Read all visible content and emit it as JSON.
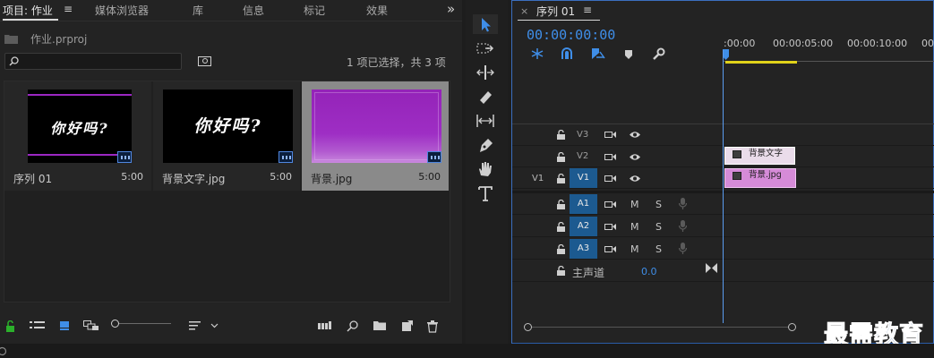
{
  "project": {
    "tabs": [
      {
        "label": "项目: 作业"
      },
      {
        "label": "媒体浏览器"
      },
      {
        "label": "库"
      },
      {
        "label": "信息"
      },
      {
        "label": "标记"
      },
      {
        "label": "效果"
      }
    ],
    "menu_icon": "≡",
    "overflow_icon": "»",
    "file_name": "作业.prproj",
    "search_placeholder": "",
    "selection_status": "1 项已选择，共 3 项",
    "items": [
      {
        "name": "序列 01",
        "duration": "5:00",
        "thumb_text": "你好吗?"
      },
      {
        "name": "背景文字.jpg",
        "duration": "5:00",
        "thumb_text": "你好吗?"
      },
      {
        "name": "背景.jpg",
        "duration": "5:00",
        "thumb_text": ""
      }
    ]
  },
  "timeline": {
    "title": "序列 01",
    "close_icon": "×",
    "menu_icon": "≡",
    "timecode": "00:00:00:00",
    "ruler_labels": [
      ":00:00",
      "00:00:05:00",
      "00:00:10:00",
      "00"
    ],
    "video_tracks": [
      {
        "label": "V3",
        "source": ""
      },
      {
        "label": "V2",
        "source": ""
      },
      {
        "label": "V1",
        "source": "V1"
      }
    ],
    "audio_tracks": [
      {
        "label": "A1",
        "m": "M",
        "s": "S"
      },
      {
        "label": "A2",
        "m": "M",
        "s": "S"
      },
      {
        "label": "A3",
        "m": "M",
        "s": "S"
      }
    ],
    "master": {
      "label": "主声道",
      "value": "0.0"
    },
    "clips": [
      {
        "track": "V2",
        "name": "背景文字"
      },
      {
        "track": "V1",
        "name": "背景.jpg"
      }
    ]
  },
  "watermark": "最需教育",
  "colors": {
    "accent": "#3f8ee8",
    "clip": "#d68bd8",
    "purple": "#9b27c2",
    "work_area": "#e0d21a",
    "target_blue": "#1c5a90"
  }
}
